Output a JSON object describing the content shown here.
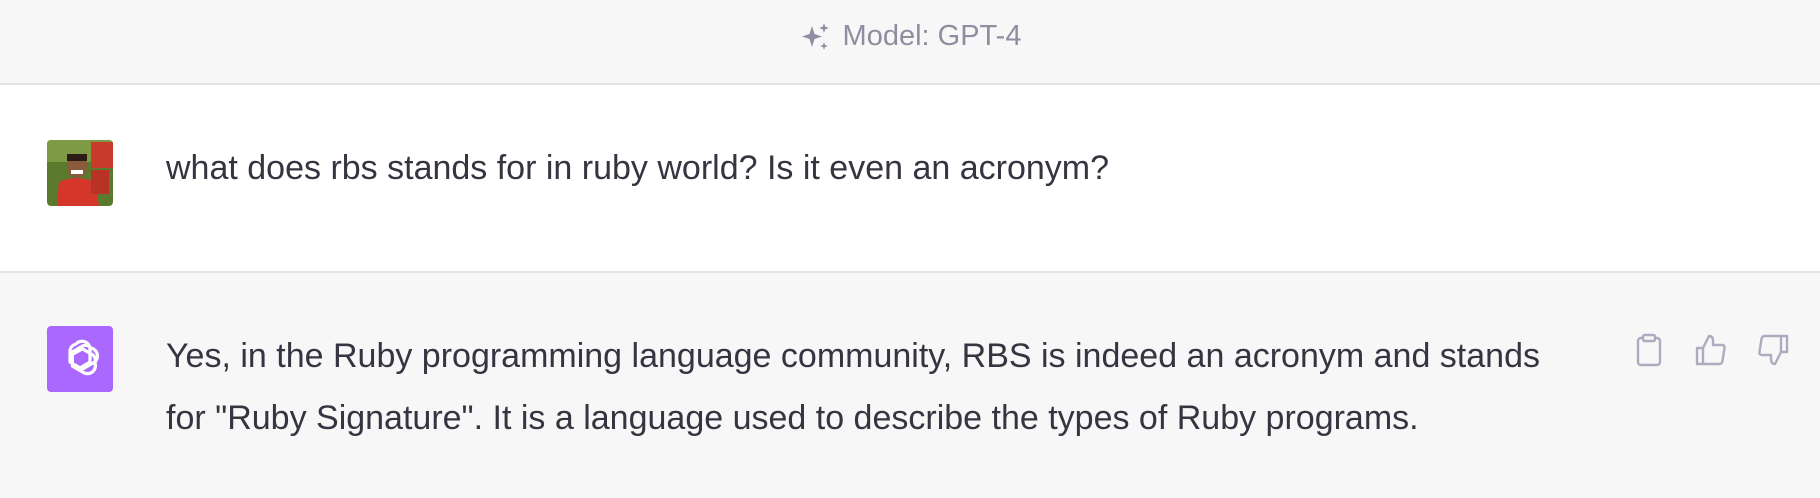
{
  "header": {
    "model_label": "Model: GPT-4",
    "icon": "sparkle-icon"
  },
  "conversation": {
    "user_message": {
      "avatar": "user-avatar",
      "text": "what does rbs stands for in ruby world? Is it even an acronym?"
    },
    "assistant_message": {
      "avatar": "openai-logo-icon",
      "avatar_color": "#ab68ff",
      "text": "Yes, in the Ruby programming language community, RBS is indeed an acronym and stands for \"Ruby Signature\". It is a language used to describe the types of Ruby programs.",
      "actions": [
        "clipboard-icon",
        "thumbs-up-icon",
        "thumbs-down-icon"
      ]
    }
  }
}
